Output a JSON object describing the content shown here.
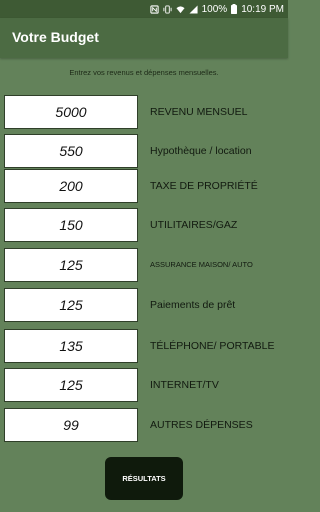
{
  "status_bar": {
    "battery": "100%",
    "time": "10:19 PM"
  },
  "app_bar": {
    "title": "Votre Budget"
  },
  "instruction": "Entrez vos revenus et dépenses mensuelles.",
  "fields": [
    {
      "value": "5000",
      "label": "REVENU MENSUEL"
    },
    {
      "value": "550",
      "label": "Hypothèque / location"
    },
    {
      "value": "200",
      "label": "TAXE DE PROPRIÉTÉ"
    },
    {
      "value": "150",
      "label": "UTILITAIRES/GAZ"
    },
    {
      "value": "125",
      "label": "ASSURANCE MAISON/ AUTO"
    },
    {
      "value": "125",
      "label": "Paiements de prêt"
    },
    {
      "value": "135",
      "label": "TÉLÉPHONE/ PORTABLE"
    },
    {
      "value": "125",
      "label": "INTERNET/TV"
    },
    {
      "value": "99",
      "label": "AUTRES DÉPENSES"
    }
  ],
  "results_button": "RÉSULTATS"
}
